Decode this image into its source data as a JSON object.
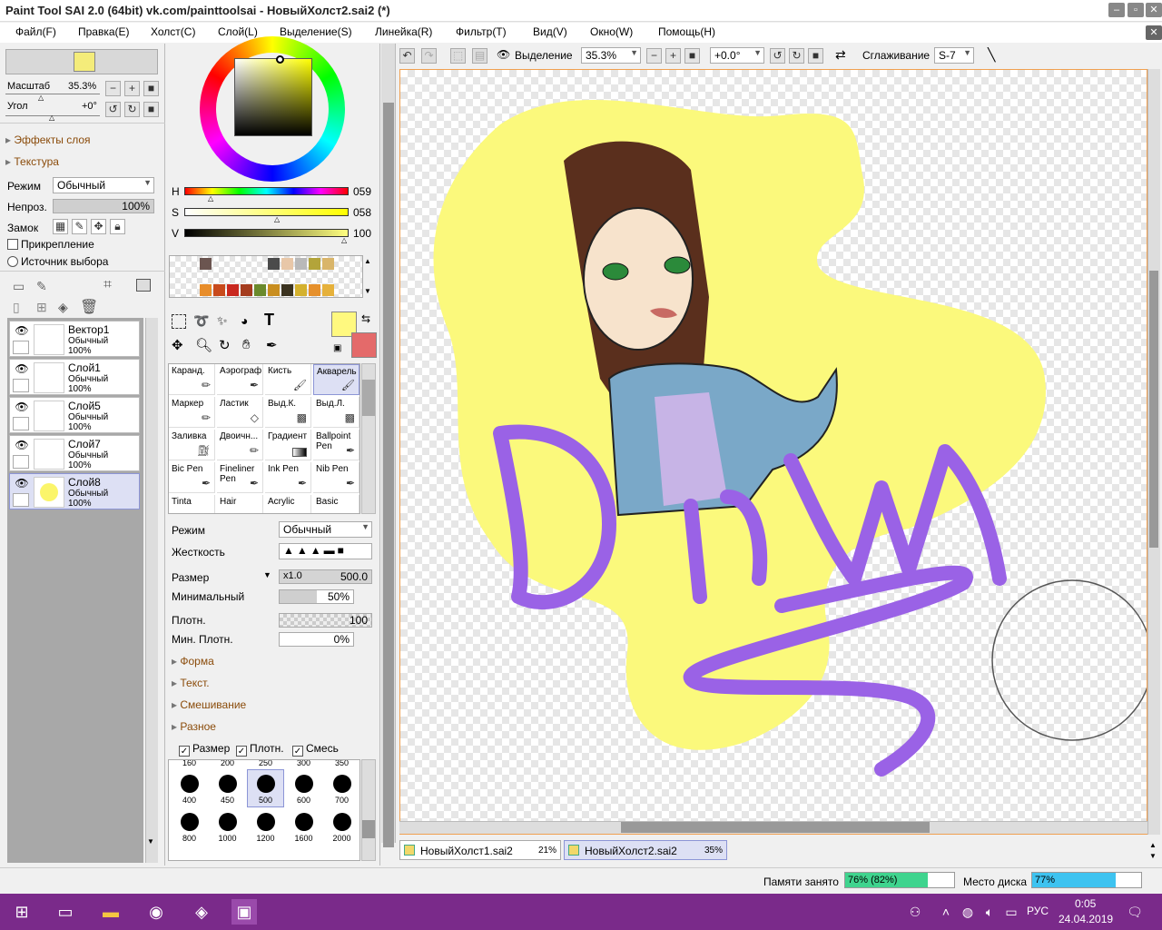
{
  "window": {
    "title": "Paint Tool SAI 2.0 (64bit) vk.com/painttoolsai - НовыйХолст2.sai2 (*)"
  },
  "menu": [
    "Файл(F)",
    "Правка(E)",
    "Холст(C)",
    "Слой(L)",
    "Выделение(S)",
    "Линейка(R)",
    "Фильтр(T)",
    "Вид(V)",
    "Окно(W)",
    "Помощь(H)"
  ],
  "navigator": {
    "scale_label": "Масштаб",
    "scale_value": "35.3%",
    "angle_label": "Угол",
    "angle_value": "+0°"
  },
  "layer_panel": {
    "effects": "Эффекты слоя",
    "texture": "Текстура",
    "mode_label": "Режим",
    "mode_value": "Обычный",
    "opacity_label": "Непроз.",
    "opacity_value": "100%",
    "lock_label": "Замок",
    "clipping": "Прикрепление",
    "selection_source": "Источник выбора",
    "layers": [
      {
        "name": "Вектор1",
        "mode": "Обычный",
        "opacity": "100%"
      },
      {
        "name": "Слой1",
        "mode": "Обычный",
        "opacity": "100%"
      },
      {
        "name": "Слой5",
        "mode": "Обычный",
        "opacity": "100%"
      },
      {
        "name": "Слой7",
        "mode": "Обычный",
        "opacity": "100%"
      },
      {
        "name": "Слой8",
        "mode": "Обычный",
        "opacity": "100%"
      }
    ]
  },
  "color": {
    "h_label": "H",
    "h_value": "059",
    "s_label": "S",
    "s_value": "058",
    "v_label": "V",
    "v_value": "100",
    "fg": "#fff97f",
    "bg": "#e46a6a"
  },
  "tools": [
    {
      "label": "Каранд."
    },
    {
      "label": "Аэрограф"
    },
    {
      "label": "Кисть"
    },
    {
      "label": "Акварель"
    },
    {
      "label": "Маркер"
    },
    {
      "label": "Ластик"
    },
    {
      "label": "Выд.К."
    },
    {
      "label": "Выд.Л."
    },
    {
      "label": "Заливка"
    },
    {
      "label": "Двоичн..."
    },
    {
      "label": "Градиент"
    },
    {
      "label": "Ballpoint Pen"
    },
    {
      "label": "Bic Pen"
    },
    {
      "label": "Fineliner Pen"
    },
    {
      "label": "Ink Pen"
    },
    {
      "label": "Nib Pen"
    },
    {
      "label": "Tinta"
    },
    {
      "label": "Hair"
    },
    {
      "label": "Acrylic"
    },
    {
      "label": "Basic"
    }
  ],
  "brush": {
    "mode_label": "Режим",
    "mode_value": "Обычный",
    "hardness_label": "Жесткость",
    "size_label": "Размер",
    "size_mult": "x1.0",
    "size_value": "500.0",
    "min_label": "Минимальный",
    "min_value": "50%",
    "density_label": "Плотн.",
    "density_value": "100",
    "min_density_label": "Мин. Плотн.",
    "min_density_value": "0%",
    "sections": [
      "Форма",
      "Текст.",
      "Смешивание",
      "Разное"
    ],
    "checks": [
      "Размер",
      "Плотн.",
      "Смесь"
    ],
    "size_top": [
      "160",
      "200",
      "250",
      "300",
      "350"
    ],
    "size_row1": [
      "400",
      "450",
      "500",
      "600",
      "700"
    ],
    "size_row2": [
      "800",
      "1000",
      "1200",
      "1600",
      "2000"
    ]
  },
  "toolbar": {
    "selection": "Выделение",
    "zoom": "35.3%",
    "angle": "+0.0°",
    "smoothing": "Сглаживание",
    "smoothing_value": "S-7"
  },
  "canvas": {
    "artwork_text": "Darwa"
  },
  "tabs": [
    {
      "name": "НовыйХолст1.sai2",
      "zoom": "21%"
    },
    {
      "name": "НовыйХолст2.sai2",
      "zoom": "35%"
    }
  ],
  "status": {
    "memory_label": "Памяти занято",
    "memory_value": "76% (82%)",
    "memory_fraction": 0.76,
    "disk_label": "Место диска",
    "disk_value": "77%",
    "disk_fraction": 0.77
  },
  "taskbar": {
    "lang": "РУС",
    "time": "0:05",
    "date": "24.04.2019"
  }
}
